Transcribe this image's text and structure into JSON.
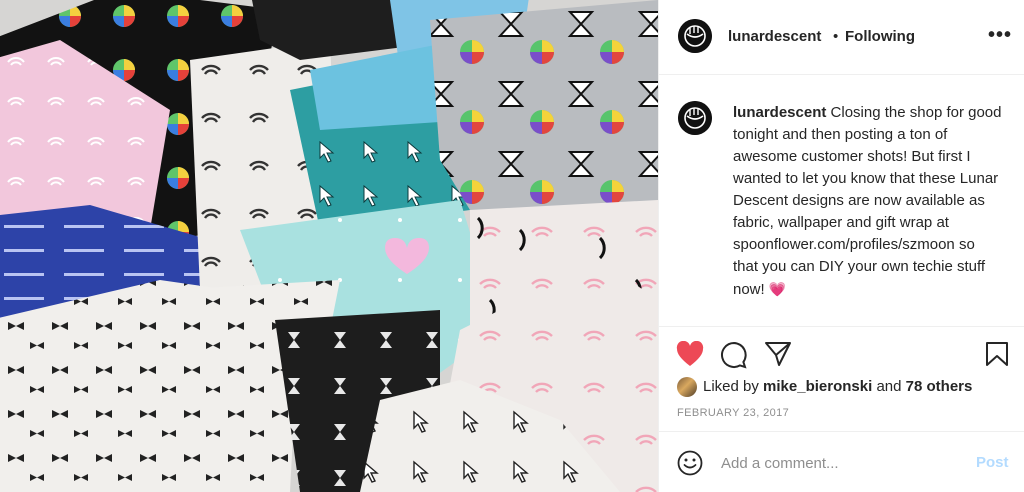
{
  "post": {
    "photo_description_icon": "fabric-photo"
  },
  "header": {
    "username": "lunardescent",
    "separator": "•",
    "follow_label": "Following",
    "more_icon": "more-options-icon",
    "more_label": "•••"
  },
  "caption": {
    "username": "lunardescent",
    "text": "Closing the shop for good tonight and then posting a ton of awesome customer shots! But first I wanted to let you know that these Lunar Descent designs are now available as fabric, wallpaper and gift wrap at spoonflower.com/profiles/szmoon so that you can DIY your own techie stuff now!",
    "emoji": "💗"
  },
  "actions": {
    "like_icon": "heart-icon",
    "comment_icon": "comment-icon",
    "share_icon": "share-icon",
    "save_icon": "bookmark-icon",
    "liked_state": true,
    "like_color": "#ed4956"
  },
  "likes": {
    "prefix": "Liked by",
    "user": "mike_bieronski",
    "joiner": "and",
    "others": "78 others"
  },
  "date": "FEBRUARY 23, 2017",
  "comment_box": {
    "placeholder": "Add a comment...",
    "post_label": "Post",
    "post_color": "#b3dbff"
  }
}
